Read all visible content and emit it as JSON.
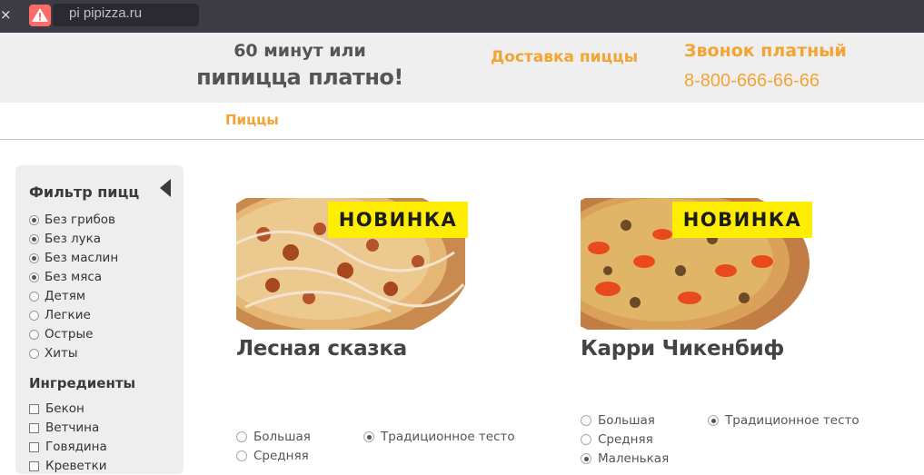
{
  "browser": {
    "close_glyph": "×",
    "url": "pi pipizza.ru"
  },
  "header": {
    "slogan_line1": "60 минут или",
    "slogan_line2": "пипицца платно!",
    "delivery_label": "Доставка пиццы",
    "call_label": "Звонок платный",
    "phone": "8-800-666-66-66"
  },
  "nav": {
    "pizzas_link": "Пиццы"
  },
  "sidebar": {
    "filter_title": "Фильтр пицц",
    "filters": [
      {
        "label": "Без грибов",
        "checked": true
      },
      {
        "label": "Без лука",
        "checked": true
      },
      {
        "label": "Без маслин",
        "checked": true
      },
      {
        "label": "Без мяса",
        "checked": true
      },
      {
        "label": "Детям",
        "checked": false
      },
      {
        "label": "Легкие",
        "checked": false
      },
      {
        "label": "Острые",
        "checked": false
      },
      {
        "label": "Хиты",
        "checked": false
      }
    ],
    "ingredients_title": "Ингредиенты",
    "ingredients": [
      {
        "label": "Бекон",
        "checked": false
      },
      {
        "label": "Ветчина",
        "checked": false
      },
      {
        "label": "Говядина",
        "checked": false
      },
      {
        "label": "Креветки",
        "checked": false
      }
    ]
  },
  "products": [
    {
      "badge": "НОВИНКА",
      "name": "Лесная сказка",
      "sizes": [
        {
          "label": "Большая",
          "selected": false
        },
        {
          "label": "Средняя",
          "selected": false
        }
      ],
      "dough": {
        "label": "Традиционное тесто",
        "selected": true
      }
    },
    {
      "badge": "НОВИНКА",
      "name": "Карри Чикенбиф",
      "sizes": [
        {
          "label": "Большая",
          "selected": false
        },
        {
          "label": "Средняя",
          "selected": false
        },
        {
          "label": "Маленькая",
          "selected": true
        }
      ],
      "dough": {
        "label": "Традиционное тесто",
        "selected": true
      }
    }
  ],
  "colors": {
    "accent_orange": "#f4a434",
    "badge_yellow": "#ffee00",
    "header_bg": "#efefef",
    "sidebar_bg": "#eeeeee",
    "browser_bar": "#3d3c44",
    "warning_red": "#ff6b6b"
  },
  "icons": {
    "close": "close-icon",
    "site_warning": "warning-icon",
    "collapse": "collapse-left-icon"
  }
}
